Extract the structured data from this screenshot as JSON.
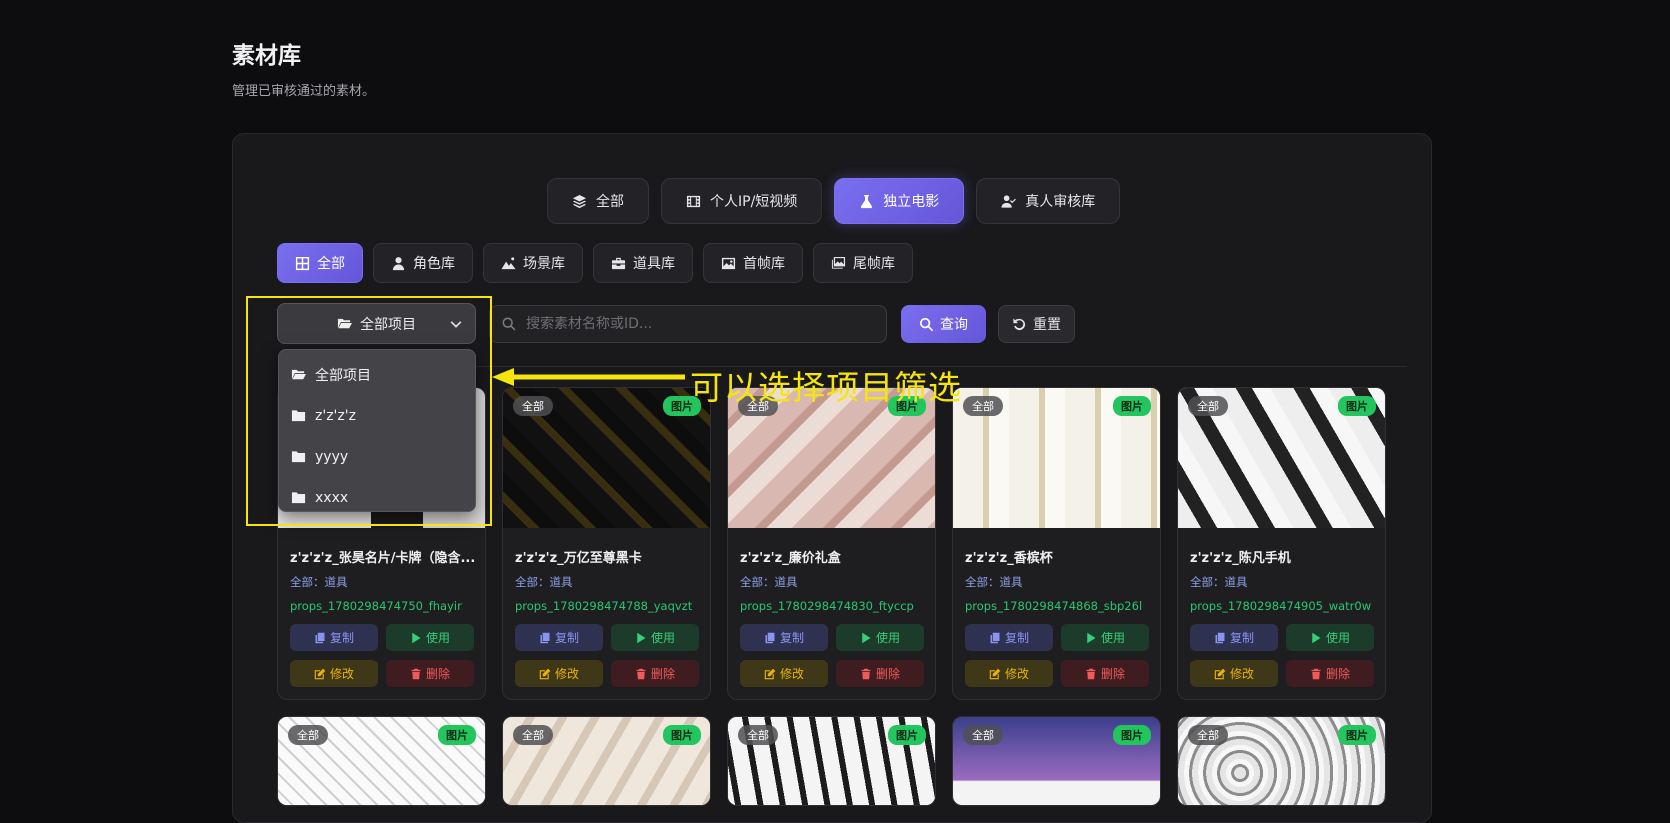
{
  "header": {
    "title": "素材库",
    "subtitle": "管理已审核通过的素材。"
  },
  "category_tabs": [
    {
      "label": "全部",
      "icon": "layers-icon"
    },
    {
      "label": "个人IP/短视频",
      "icon": "film-icon"
    },
    {
      "label": "独立电影",
      "icon": "flask-icon",
      "active": true
    },
    {
      "label": "真人审核库",
      "icon": "user-check-icon"
    }
  ],
  "type_tabs": [
    {
      "label": "全部",
      "icon": "grid-icon",
      "active": true
    },
    {
      "label": "角色库",
      "icon": "user-icon"
    },
    {
      "label": "场景库",
      "icon": "mountain-icon"
    },
    {
      "label": "道具库",
      "icon": "toolbox-icon"
    },
    {
      "label": "首帧库",
      "icon": "image-icon"
    },
    {
      "label": "尾帧库",
      "icon": "images-icon"
    }
  ],
  "filters": {
    "project_select": "全部项目",
    "search_placeholder": "搜索素材名称或ID...",
    "query_label": "查询",
    "reset_label": "重置"
  },
  "project_dropdown": {
    "items": [
      "全部项目",
      "z'z'z'z",
      "yyyy",
      "xxxx"
    ]
  },
  "annotation": {
    "text": "可以选择项目筛选",
    "color": "#f5e50c"
  },
  "card_badges": {
    "scope": "全部",
    "type": "图片"
  },
  "card_buttons": {
    "copy": "复制",
    "use": "使用",
    "edit": "修改",
    "delete": "删除"
  },
  "cards": [
    {
      "name": "z'z'z'z_张昊名片/卡牌（隐含...",
      "category": "全部：道具",
      "id": "props_1780298474750_fhayir"
    },
    {
      "name": "z'z'z'z_万亿至尊黑卡",
      "category": "全部：道具",
      "id": "props_1780298474788_yaqvzt"
    },
    {
      "name": "z'z'z'z_廉价礼盒",
      "category": "全部：道具",
      "id": "props_1780298474830_ftyccp"
    },
    {
      "name": "z'z'z'z_香槟杯",
      "category": "全部：道具",
      "id": "props_1780298474868_sbp26l"
    },
    {
      "name": "z'z'z'z_陈凡手机",
      "category": "全部：道具",
      "id": "props_1780298474905_watr0w"
    }
  ],
  "colors": {
    "accent": "#7a6ff0",
    "success": "#22c55e",
    "warning": "#eab308",
    "danger": "#f05a5a"
  }
}
